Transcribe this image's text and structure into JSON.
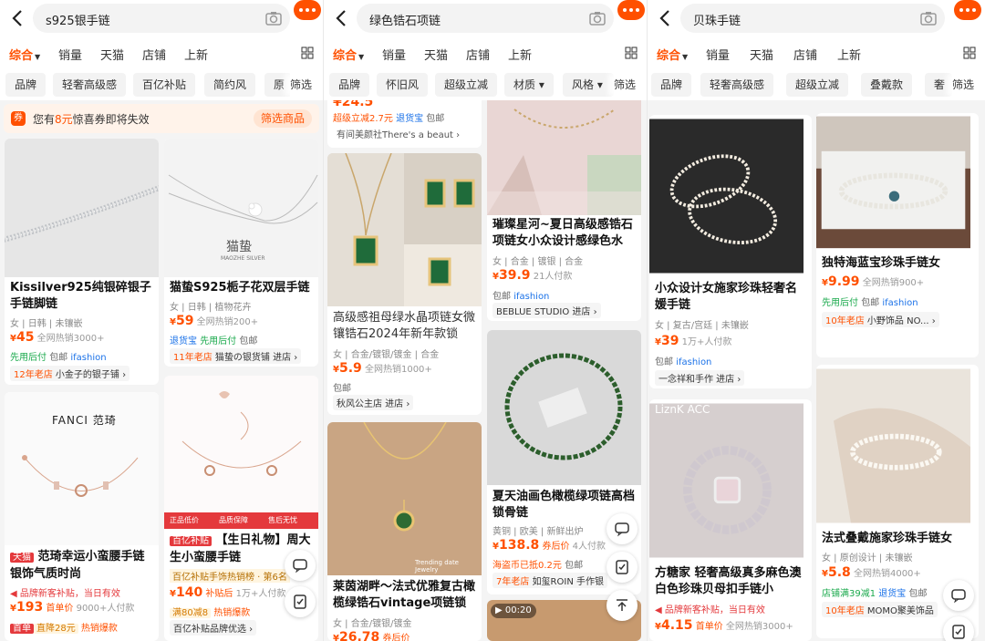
{
  "screens": [
    {
      "query": "s925银手链",
      "sort": [
        "综合",
        "销量",
        "天猫",
        "店铺",
        "上新"
      ],
      "filters": [
        "品牌",
        "轻奢高级感",
        "百亿补贴",
        "简约风",
        "原"
      ],
      "filter_btn": "筛选",
      "coupon": {
        "pre": "您有",
        "amount": "8元",
        "post": "惊喜券即将失效",
        "button": "筛选商品"
      },
      "cards": [
        {
          "title": "Kissilver925纯银碎银子手链脚链",
          "tags": "女 | 日韩 | 未镶嵌",
          "price_sym": "¥",
          "price": "45",
          "sold": "全网热销3000+",
          "badge1": "先用后付",
          "badge2": "包邮",
          "badge3": "ifashion",
          "shop_label": "12年老店",
          "shop": "小金子的银子铺 ›"
        },
        {
          "title": "猫蛰S925栀子花双层手链",
          "tags": "女 | 日韩 | 植物花卉",
          "price_sym": "¥",
          "price": "59",
          "sold": "全网热销200+",
          "badge1": "退货宝",
          "badge2": "先用后付",
          "badge3": "包邮",
          "shop_label": "11年老店",
          "shop": "猫蛰の银货铺 进店 ›",
          "img_text": "猫蛰",
          "img_sub": "MAOZHE SILVER"
        },
        {
          "title": "范琦幸运小蛮腰手链银饰气质时尚",
          "tag_red": "天猫",
          "promo": "品牌新客补贴，当日有效",
          "price_sym": "¥",
          "price": "193",
          "price_note": "首单价",
          "sold": "9000+人付款",
          "extra1": "首单",
          "extra2": "直降28元",
          "extra3": "热销爆款",
          "img_text": "FANCI 范琦"
        },
        {
          "title": "【生日礼物】周大生小蛮腰手链",
          "tag_red": "百亿补贴",
          "promo": "百亿补贴手饰热销榜 · 第6名",
          "price_sym": "¥",
          "price": "140",
          "price_note": "补贴后",
          "sold": "1万+人付款",
          "extra1": "满80减8",
          "extra2": "热销爆款",
          "shop": "百亿补贴品牌优选 ›",
          "strip": [
            "正品低价",
            "品质保障",
            "售后无忧"
          ]
        }
      ]
    },
    {
      "query": "绿色锆石项链",
      "sort": [
        "综合",
        "销量",
        "天猫",
        "店铺",
        "上新"
      ],
      "filters": [
        "品牌",
        "怀旧风",
        "超级立减",
        "材质",
        "风格"
      ],
      "filter_btn": "筛选",
      "top_partial": {
        "price": "¥24.5",
        "promo1": "超级立减2.7元",
        "promo2": "退货宝",
        "promo3": "包邮",
        "shop": "有间美颜社There's a beaut ›"
      },
      "cards": [
        {
          "title": "璀璨星河~夏日高级感锆石项链女小众设计感绿色水",
          "tags": "女 | 合金 | 镀银 | 合金",
          "price_sym": "¥",
          "price": "39.9",
          "sold": "21人付款",
          "badge1": "包邮",
          "badge3": "ifashion",
          "shop": "BEBLUE STUDIO 进店 ›"
        },
        {
          "title": "高级感祖母绿水晶项链女微镶锆石2024年新年款锁",
          "tags": "女 | 合金/镀银/镀金 | 合金",
          "price_sym": "¥",
          "price": "5.9",
          "sold": "全网热销1000+",
          "badge1": "包邮",
          "shop": "秋风公主店 进店 ›"
        },
        {
          "title": "夏天油画色橄榄绿项链高档锁骨链",
          "tags": "黄铜 | 欧美 | 新鲜出炉",
          "price_sym": "¥",
          "price": "138.8",
          "price_note": "券后价",
          "sold": "4人付款",
          "badge1": "海盗币已抵0.2元",
          "badge2": "包邮",
          "shop_label": "7年老店",
          "shop": "如玺ROIN 手作银"
        },
        {
          "title": "莱茵湖畔～法式优雅复古橄榄绿锆石vintage项链锁",
          "tags": "女 | 合金/镀银/镀金",
          "price_sym": "¥",
          "price": "26.78",
          "price_note": "券后价",
          "img_text": "Trending date Jewelry"
        },
        {
          "video_time": "00:20"
        }
      ]
    },
    {
      "query": "贝珠手链",
      "sort": [
        "综合",
        "销量",
        "天猫",
        "店铺",
        "上新"
      ],
      "filters": [
        "品牌",
        "轻奢高级感",
        "超级立减",
        "叠戴款",
        "奢"
      ],
      "filter_btn": "筛选",
      "cards": [
        {
          "title": "小众设计女施家珍珠轻奢名媛手链",
          "tags": "女 | 复古/宫廷 | 未镶嵌",
          "price_sym": "¥",
          "price": "39",
          "sold": "1万+人付款",
          "badge1": "包邮",
          "badge3": "ifashion",
          "shop": "一念祥和手作 进店 ›"
        },
        {
          "title": "独特海蓝宝珍珠手链女",
          "price_sym": "¥",
          "price": "9.99",
          "sold": "全网热销900+",
          "badge1": "先用后付",
          "badge2": "包邮",
          "badge3": "ifashion",
          "shop_label": "10年老店",
          "shop": "小野饰品 NO... ›"
        },
        {
          "title": "方糖家 轻奢高级真多麻色澳白色珍珠贝母扣手链小",
          "promo": "品牌新客补贴，当日有效",
          "price_sym": "¥",
          "price": "4.15",
          "price_note": "首单价",
          "sold": "全网热销3000+",
          "img_text": "LiznK ACC"
        },
        {
          "title": "法式叠戴施家珍珠手链女",
          "tags": "女 | 原创设计 | 未镶嵌",
          "price_sym": "¥",
          "price": "5.8",
          "sold": "全网热销4000+",
          "badge1": "店铺满39减1",
          "badge2": "退货宝",
          "badge3": "包邮",
          "shop_label": "10年老店",
          "shop": "MOMO聚美饰品"
        }
      ]
    }
  ],
  "colors": {
    "accent": "#ff5000",
    "green": "#1aa94c",
    "blue": "#1b72e8",
    "red": "#e4393c"
  },
  "icons": [
    "back-arrow-icon",
    "camera-icon",
    "more-icon",
    "grid-view-icon",
    "chat-icon",
    "edit-icon",
    "scroll-top-icon"
  ]
}
